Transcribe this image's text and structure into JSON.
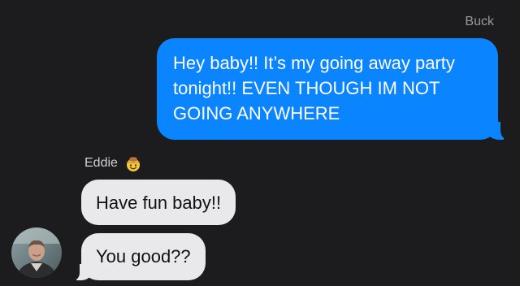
{
  "thread": {
    "outgoing": {
      "sender": "Buck",
      "text": "Hey baby!! It’s my going away party tonight!! EVEN THOUGH IM NOT GOING ANYWHERE",
      "color": "#0a84ff"
    },
    "incoming": {
      "sender": "Eddie",
      "sender_icon": "cowboy-hat-face-emoji",
      "messages": [
        {
          "text": "Have fun baby!!"
        },
        {
          "text": "You good??"
        }
      ],
      "color": "#e9e9eb",
      "avatar_icon": "contact-photo"
    }
  }
}
